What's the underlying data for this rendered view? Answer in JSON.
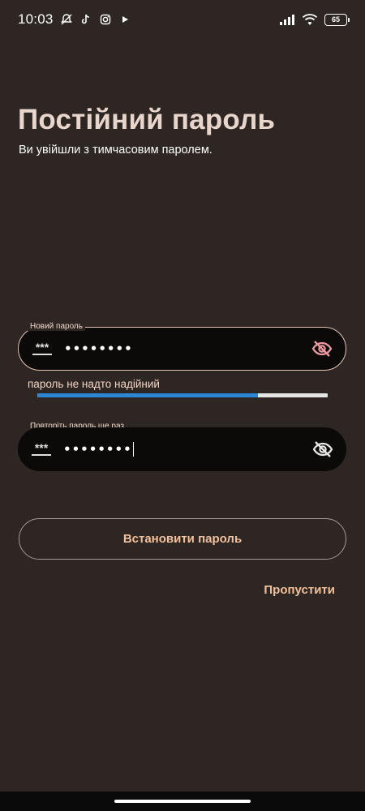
{
  "status_bar": {
    "time": "10:03",
    "battery": "65",
    "icons": [
      "bell-off-icon",
      "tiktok-icon",
      "instagram-icon",
      "play-icon",
      "signal-icon",
      "wifi-icon",
      "battery-icon"
    ]
  },
  "header": {
    "title": "Постійний пароль",
    "subtitle": "Ви увійшли з тимчасовим паролем."
  },
  "new_password": {
    "label": "Новий пароль",
    "icon_text": "***",
    "value": "••••••••"
  },
  "strength": {
    "label": "пароль не надто надійний",
    "level": 0.76,
    "fill_color": "#2a86d6"
  },
  "repeat_password": {
    "label": "Повторіть пароль ще раз",
    "icon_text": "***",
    "value": "••••••••"
  },
  "actions": {
    "set_password": "Встановити пароль",
    "skip": "Пропустити"
  },
  "colors": {
    "background": "#2d2622",
    "accent": "#f2c09c",
    "title": "#e8d6cd",
    "eye_icon": "#e89aa0"
  }
}
